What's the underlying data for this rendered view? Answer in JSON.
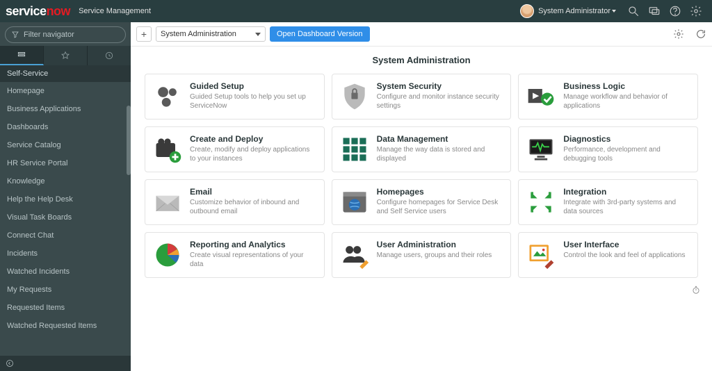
{
  "banner": {
    "app_title": "Service Management",
    "user_name": "System Administrator"
  },
  "sidebar": {
    "filter_placeholder": "Filter navigator",
    "section_header": "Self-Service",
    "items": [
      "Homepage",
      "Business Applications",
      "Dashboards",
      "Service Catalog",
      "HR Service Portal",
      "Knowledge",
      "Help the Help Desk",
      "Visual Task Boards",
      "Connect Chat",
      "Incidents",
      "Watched Incidents",
      "My Requests",
      "Requested Items",
      "Watched Requested Items"
    ]
  },
  "toolbar": {
    "breadcrumb": "System Administration",
    "open_dashboard": "Open Dashboard Version"
  },
  "page": {
    "title": "System Administration"
  },
  "cards": [
    {
      "title": "Guided Setup",
      "desc": "Guided Setup tools to help you set up ServiceNow"
    },
    {
      "title": "System Security",
      "desc": "Configure and monitor instance security settings"
    },
    {
      "title": "Business Logic",
      "desc": "Manage workflow and behavior of applications"
    },
    {
      "title": "Create and Deploy",
      "desc": "Create, modify and deploy applications to your instances"
    },
    {
      "title": "Data Management",
      "desc": "Manage the way data is stored and displayed"
    },
    {
      "title": "Diagnostics",
      "desc": "Performance, development and debugging tools"
    },
    {
      "title": "Email",
      "desc": "Customize behavior of inbound and outbound email"
    },
    {
      "title": "Homepages",
      "desc": "Configure homepages for Service Desk and Self Service users"
    },
    {
      "title": "Integration",
      "desc": "Integrate with 3rd-party systems and data sources"
    },
    {
      "title": "Reporting and Analytics",
      "desc": "Create visual representations of your data"
    },
    {
      "title": "User Administration",
      "desc": "Manage users, groups and their roles"
    },
    {
      "title": "User Interface",
      "desc": "Control the look and feel of applications"
    }
  ]
}
